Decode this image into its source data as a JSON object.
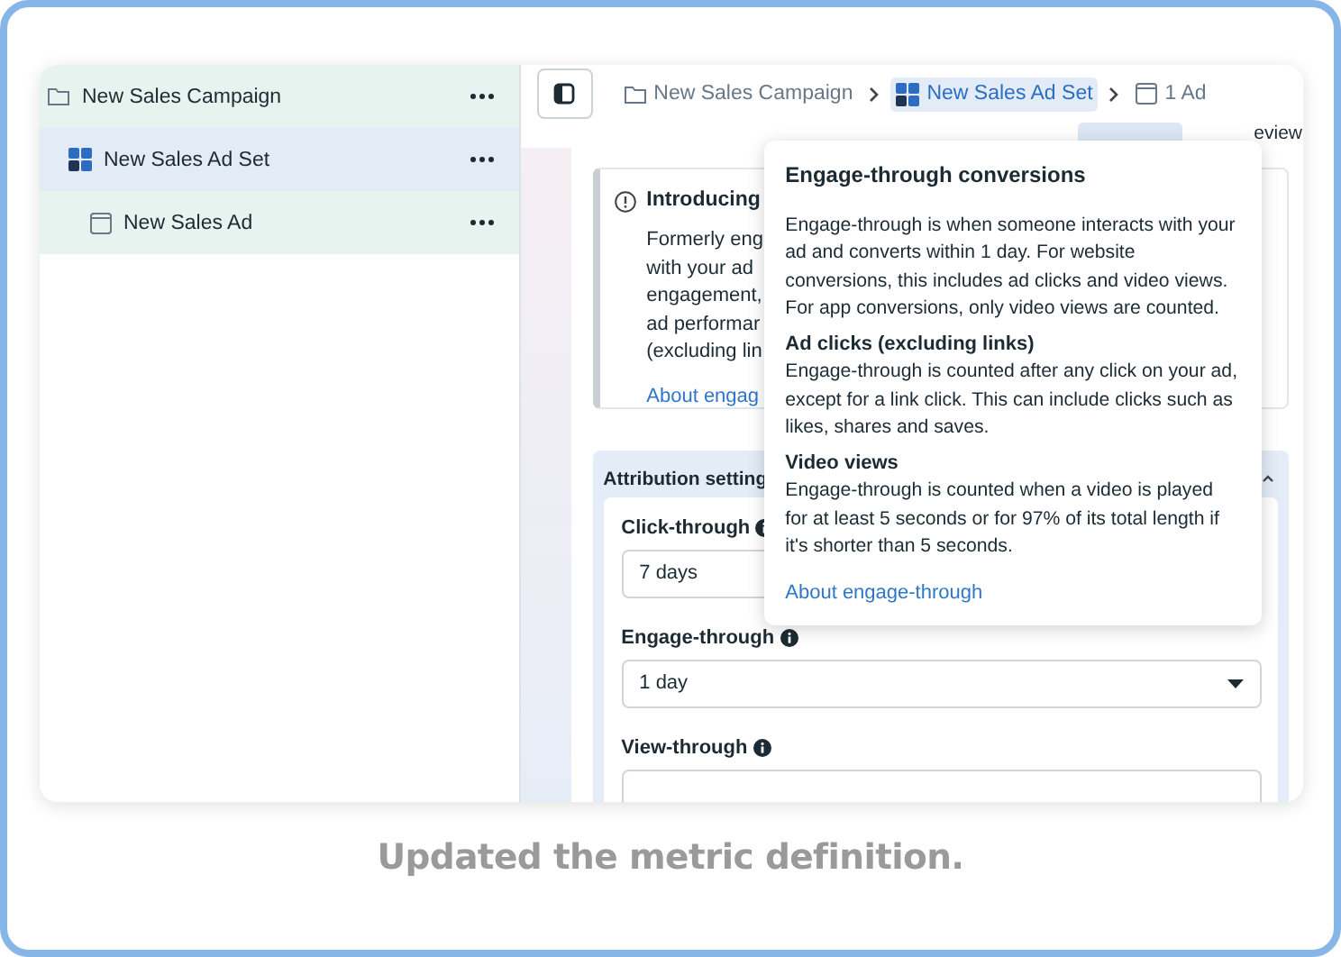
{
  "sidebar": {
    "items": [
      {
        "label": "New Sales Campaign",
        "kind": "campaign",
        "selected": false,
        "children": [
          {
            "label": "New Sales Ad Set",
            "kind": "adset",
            "selected": true,
            "children": [
              {
                "label": "New Sales Ad",
                "kind": "ad",
                "selected": false
              }
            ]
          }
        ]
      }
    ]
  },
  "breadcrumbs": [
    {
      "label": "New Sales Campaign",
      "kind": "campaign",
      "selected": false
    },
    {
      "label": "New Sales Ad Set",
      "kind": "adset",
      "selected": true
    },
    {
      "label": "1 Ad",
      "kind": "ad",
      "selected": false
    }
  ],
  "view_tabs": [
    {
      "selected": true
    },
    {
      "label": "eview",
      "selected": false
    }
  ],
  "intro_card": {
    "title": "Introducing",
    "lines": [
      "Formerly eng",
      "with your ad",
      "engagement,",
      "ad performar",
      "(excluding lin"
    ],
    "link": "About engag"
  },
  "attribution": {
    "title": "Attribution setting",
    "expanded": true,
    "fields": [
      {
        "label": "Click-through",
        "value": "7 days"
      },
      {
        "label": "Engage-through",
        "value": "1 day"
      },
      {
        "label": "View-through"
      }
    ]
  },
  "popover": {
    "title": "Engage-through conversions",
    "text": "Engage-through is when someone interacts with your ad and converts within 1 day. For website conversions, this includes ad clicks and video views. For app conversions, only video views are counted.",
    "sections": [
      {
        "heading": "Ad clicks (excluding links)",
        "text": "Engage-through is counted after any click on your ad, except for a link click. This can include clicks such as likes, shares and saves."
      },
      {
        "heading": "Video views",
        "text": "Engage-through is counted when a video is played for at least 5 seconds or for 97% of its total length if it's shorter than 5 seconds."
      }
    ],
    "link": "About engage-through"
  },
  "caption": "Updated the metric definition."
}
